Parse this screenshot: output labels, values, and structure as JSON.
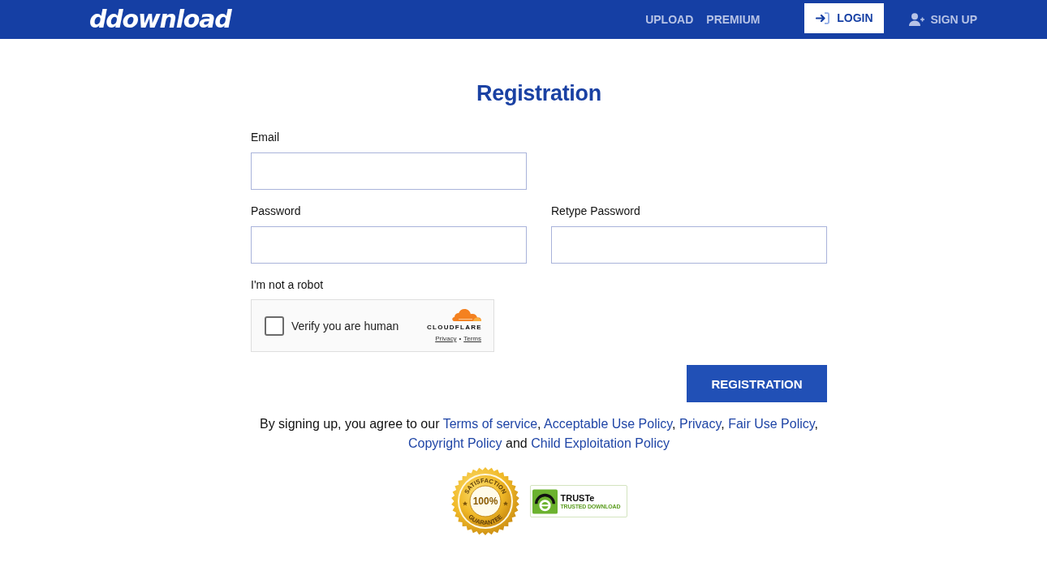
{
  "header": {
    "logo": "ddownload",
    "nav": [
      {
        "label": "UPLOAD"
      },
      {
        "label": "PREMIUM"
      }
    ],
    "login_button": {
      "label": "LOGIN"
    },
    "signup_link": {
      "label": "SIGN UP"
    }
  },
  "form": {
    "title": "Registration",
    "rows": [
      {
        "fields": [
          {
            "label": "Email"
          }
        ]
      },
      {
        "fields": [
          {
            "label": "Password"
          },
          {
            "label": "Retype Password"
          }
        ]
      }
    ],
    "captcha": {
      "label": "I'm not a robot",
      "checkbox_label": "Verify you are human",
      "checked": false,
      "brand": "CLOUDFLARE",
      "links": [
        "Privacy",
        "Terms"
      ],
      "separator": "•"
    },
    "submit": "REGISTRATION"
  },
  "agreement": [
    {
      "kind": "text",
      "text": "By signing up, you agree to our "
    },
    {
      "kind": "link",
      "text": "Terms of service"
    },
    {
      "kind": "text",
      "text": ", "
    },
    {
      "kind": "link",
      "text": "Acceptable Use Policy"
    },
    {
      "kind": "text",
      "text": ", "
    },
    {
      "kind": "link",
      "text": "Privacy"
    },
    {
      "kind": "text",
      "text": ", "
    },
    {
      "kind": "link",
      "text": "Fair Use Policy"
    },
    {
      "kind": "text",
      "text": ", "
    },
    {
      "kind": "link",
      "text": "Copyright Policy"
    },
    {
      "kind": "text",
      "text": " and "
    },
    {
      "kind": "link",
      "text": "Child Exploitation Policy"
    }
  ],
  "badges": {
    "guarantee": {
      "top": "SATISFACTION",
      "center": "100%",
      "bottom": "GUARANTEE"
    },
    "truste": {
      "title": "TRUSTe",
      "subtitle": "TRUSTED DOWNLOAD"
    }
  }
}
